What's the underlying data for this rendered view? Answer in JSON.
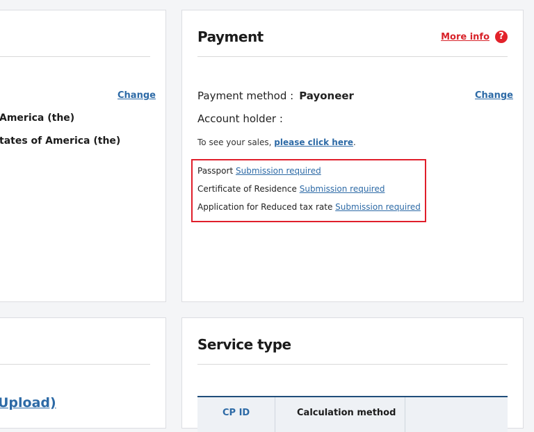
{
  "left_top": {
    "change_label": "Change",
    "line1": "America (the)",
    "line2": "tates of America (the)"
  },
  "payment": {
    "title": "Payment",
    "more_info_label": "More info",
    "help_icon": "?",
    "method_label": "Payment method :",
    "method_value": "Payoneer",
    "change_label": "Change",
    "account_holder_label": "Account holder :",
    "sales_text": "To see your sales, ",
    "sales_link": "please click here",
    "sales_suffix": ".",
    "documents": [
      {
        "label": "Passport",
        "status": "Submission required"
      },
      {
        "label": "Certificate of Residence",
        "status": "Submission required"
      },
      {
        "label": "Application for Reduced tax rate",
        "status": "Submission required"
      }
    ]
  },
  "left_bottom": {
    "upload_label": "Upload)"
  },
  "service": {
    "title": "Service type",
    "columns": [
      "CP ID",
      "Calculation method"
    ]
  },
  "colors": {
    "accent_blue": "#2d6aa6",
    "alert_red": "#e01e2a",
    "header_navy": "#1f4d7a"
  }
}
